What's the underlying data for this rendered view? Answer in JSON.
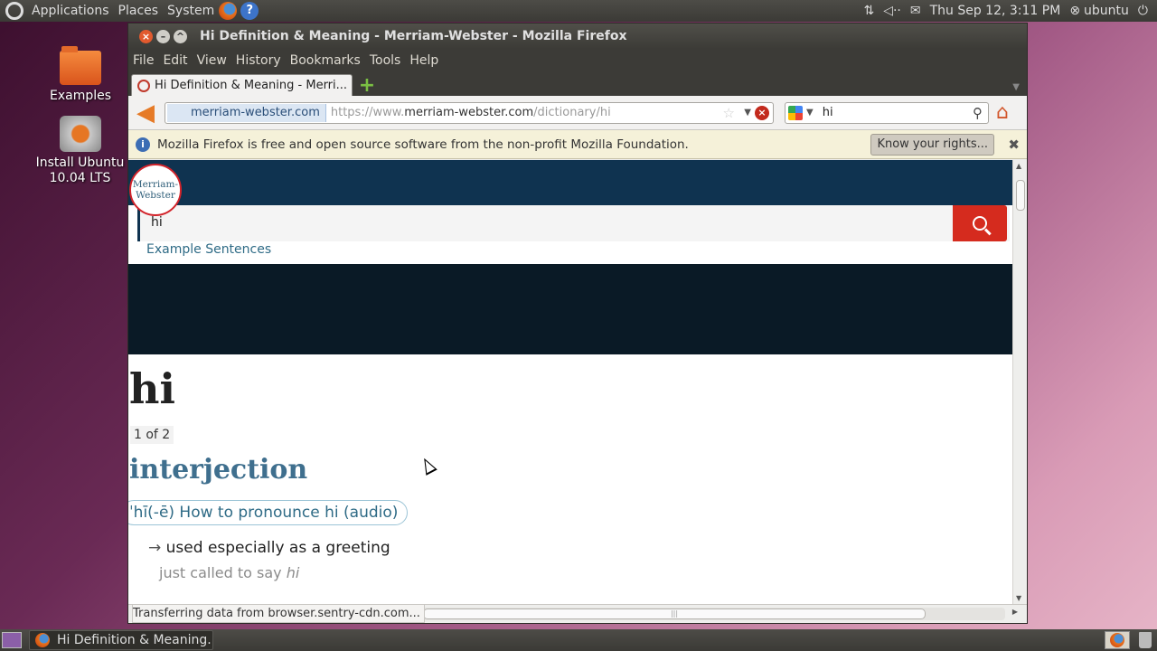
{
  "top_panel": {
    "menus": [
      "Applications",
      "Places",
      "System"
    ],
    "datetime": "Thu Sep 12,  3:11 PM",
    "user": "ubuntu"
  },
  "desktop": {
    "icons": [
      {
        "label": "Examples",
        "icon": "folder-icon"
      },
      {
        "label": "Install Ubuntu 10.04 LTS",
        "icon": "installer-icon"
      }
    ]
  },
  "window": {
    "title": "Hi Definition & Meaning - Merriam-Webster - Mozilla Firefox",
    "menu": [
      "File",
      "Edit",
      "View",
      "History",
      "Bookmarks",
      "Tools",
      "Help"
    ],
    "tab": {
      "label": "Hi Definition & Meaning - Merri..."
    },
    "url_identity": "merriam-webster.com",
    "url_prefix": "https://www.",
    "url_host": "merriam-webster.com",
    "url_path": "/dictionary/hi",
    "search_value": "hi",
    "info_message": "Mozilla Firefox is free and open source software from the non-profit Mozilla Foundation.",
    "info_button": "Know your rights...",
    "status": "Transferring data from browser.sentry-cdn.com..."
  },
  "page": {
    "logo_line1": "Merriam-",
    "logo_line2": "Webster",
    "search_value": "hi",
    "example_link": "Example Sentences",
    "word": "hi",
    "entry_count": "1 of 2",
    "part_of_speech": "interjection",
    "pronunciation": "ˈhī(-ē) How to pronounce hi (audio)",
    "definition_arrow": "→",
    "definition": "used especially as a greeting",
    "example_prefix": "just called to say ",
    "example_word": "hi"
  },
  "taskbar": {
    "task_label": "Hi Definition & Meaning..."
  },
  "colors": {
    "mw_navy": "#0f3350",
    "mw_red": "#d52b1e",
    "mw_blue": "#3f6f8e",
    "panel": "#3c3b37"
  }
}
